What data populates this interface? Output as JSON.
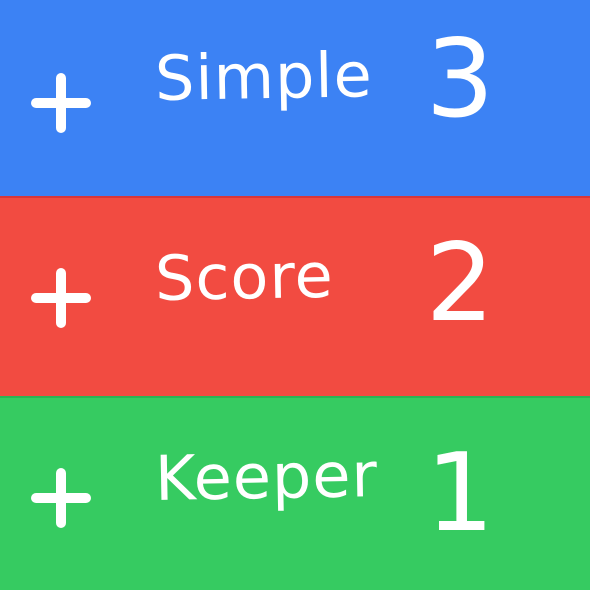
{
  "rows": [
    {
      "label": "Simple",
      "score": "3",
      "color": "#3c82f4",
      "icon": "plus-icon"
    },
    {
      "label": "Score",
      "score": "2",
      "color": "#f24b41",
      "icon": "plus-icon"
    },
    {
      "label": "Keeper",
      "score": "1",
      "color": "#36cb61",
      "icon": "plus-icon"
    }
  ]
}
